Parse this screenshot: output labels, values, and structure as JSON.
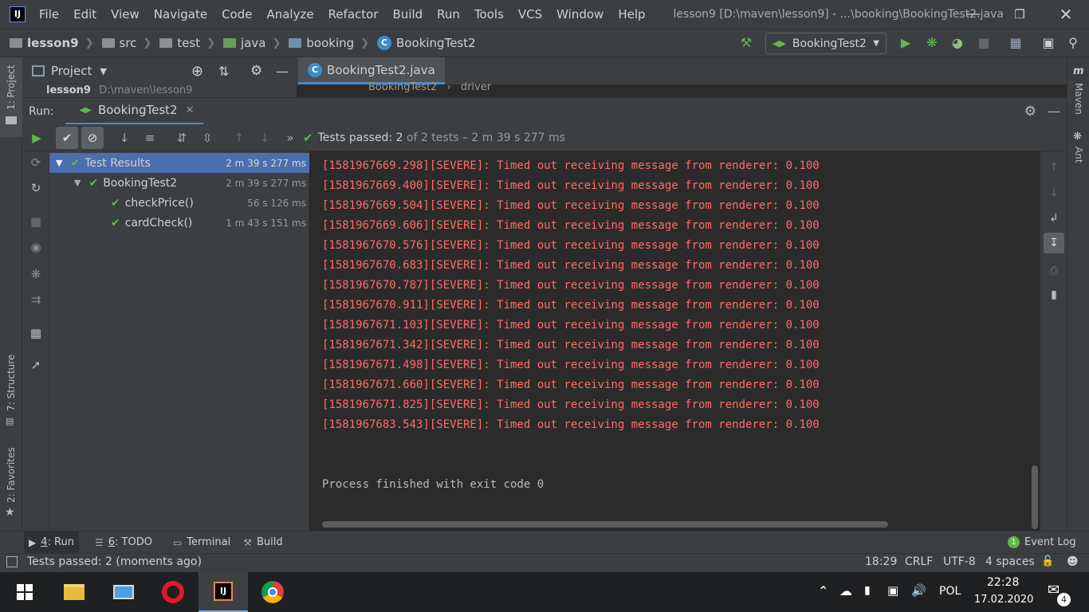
{
  "window": {
    "title": "lesson9 [D:\\maven\\lesson9] - ...\\booking\\BookingTest2.java",
    "logo": "IJ"
  },
  "menu": [
    "File",
    "Edit",
    "View",
    "Navigate",
    "Code",
    "Analyze",
    "Refactor",
    "Build",
    "Run",
    "Tools",
    "VCS",
    "Window",
    "Help"
  ],
  "breadcrumb": [
    "lesson9",
    "src",
    "test",
    "java",
    "booking",
    "BookingTest2"
  ],
  "run_config": {
    "label": "BookingTest2"
  },
  "project_panel": {
    "title": "Project",
    "root_label": "lesson9",
    "root_path": "D:\\maven\\lesson9"
  },
  "editor": {
    "tab": "BookingTest2.java",
    "crumb_class": "BookingTest2",
    "crumb_member": "driver"
  },
  "run_panel": {
    "label": "Run:",
    "tab": "BookingTest2"
  },
  "test_status": {
    "prefix": "Tests passed:",
    "passed": "2",
    "suffix": "of 2 tests – 2 m 39 s 277 ms"
  },
  "tree": [
    {
      "label": "Test Results",
      "time": "2 m 39 s 277 ms"
    },
    {
      "label": "BookingTest2",
      "time": "2 m 39 s 277 ms"
    },
    {
      "label": "checkPrice()",
      "time": "56 s 126 ms"
    },
    {
      "label": "cardCheck()",
      "time": "1 m 43 s 151 ms"
    }
  ],
  "console": {
    "lines": [
      "[1581967669.298][SEVERE]: Timed out receiving message from renderer: 0.100",
      "[1581967669.400][SEVERE]: Timed out receiving message from renderer: 0.100",
      "[1581967669.504][SEVERE]: Timed out receiving message from renderer: 0.100",
      "[1581967669.606][SEVERE]: Timed out receiving message from renderer: 0.100",
      "[1581967670.576][SEVERE]: Timed out receiving message from renderer: 0.100",
      "[1581967670.683][SEVERE]: Timed out receiving message from renderer: 0.100",
      "[1581967670.787][SEVERE]: Timed out receiving message from renderer: 0.100",
      "[1581967670.911][SEVERE]: Timed out receiving message from renderer: 0.100",
      "[1581967671.103][SEVERE]: Timed out receiving message from renderer: 0.100",
      "[1581967671.342][SEVERE]: Timed out receiving message from renderer: 0.100",
      "[1581967671.498][SEVERE]: Timed out receiving message from renderer: 0.100",
      "[1581967671.660][SEVERE]: Timed out receiving message from renderer: 0.100",
      "[1581967671.825][SEVERE]: Timed out receiving message from renderer: 0.100",
      "[1581967683.543][SEVERE]: Timed out receiving message from renderer: 0.100"
    ],
    "finish": "Process finished with exit code 0"
  },
  "side_tabs": {
    "project": "1: Project",
    "structure": "7: Structure",
    "favorites": "2: Favorites",
    "maven": "Maven",
    "ant": "Ant"
  },
  "bottom_tabs": [
    {
      "num": "4",
      "label": ": Run"
    },
    {
      "num": "6",
      "label": ": TODO"
    },
    {
      "num": "",
      "label": "Terminal"
    },
    {
      "num": "",
      "label": "Build"
    }
  ],
  "event_log": {
    "count": "1",
    "label": "Event Log"
  },
  "status": {
    "message": "Tests passed: 2 (moments ago)",
    "position": "18:29",
    "line_sep": "CRLF",
    "encoding": "UTF-8",
    "indent": "4 spaces"
  },
  "taskbar": {
    "time": "22:28",
    "date": "17.02.2020",
    "lang": "POL",
    "notifications": "4"
  },
  "colors": {
    "accent": "#4a88c7",
    "error_text": "#ff6b68",
    "pass": "#5fb848",
    "selection": "#4b6eaf"
  }
}
